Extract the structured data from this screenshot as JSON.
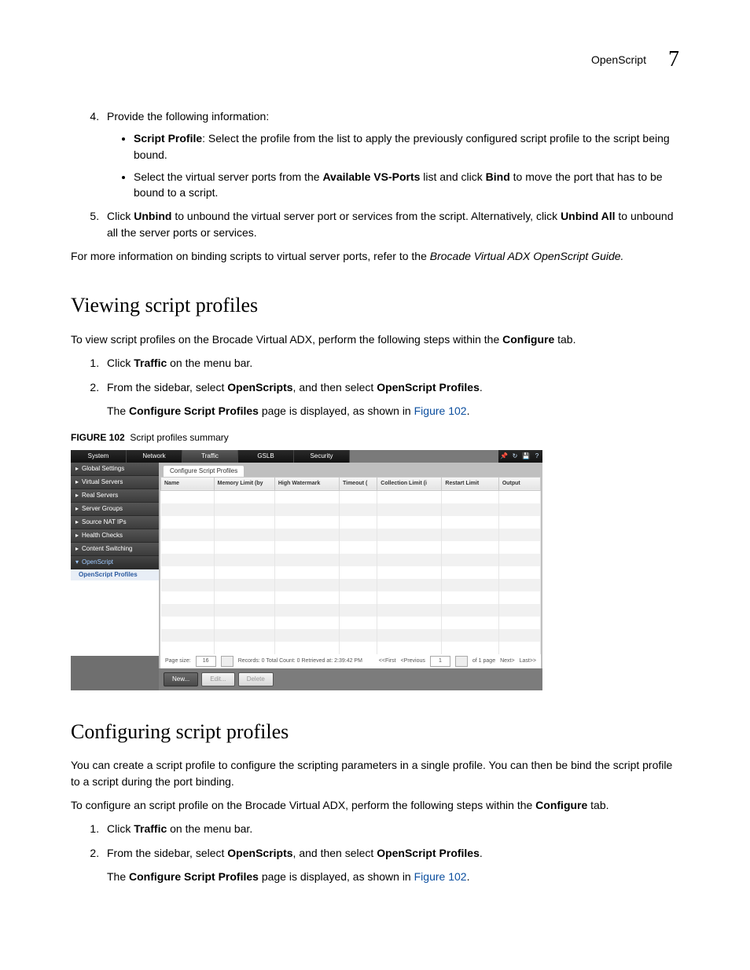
{
  "header": {
    "section": "OpenScript",
    "pagenum": "7"
  },
  "step4": {
    "num": "4.",
    "lead": "Provide the following information:",
    "b1_bold": "Script Profile",
    "b1_rest": ": Select the profile from the list to apply the previously configured script profile to the script being bound.",
    "b2_a": "Select the virtual server ports from the ",
    "b2_bold1": "Available VS-Ports",
    "b2_b": " list and click ",
    "b2_bold2": "Bind",
    "b2_c": " to move the port that has to be bound to a script."
  },
  "step5": {
    "num": "5.",
    "a": "Click ",
    "bold1": "Unbind",
    "b": " to unbound the virtual server port or services from the script. Alternatively, click ",
    "bold2": "Unbind All",
    "c": " to unbound all the server ports or services."
  },
  "para_ref": {
    "a": "For more information on binding scripts to virtual server ports, refer to the ",
    "i": "Brocade Virtual ADX OpenScript Guide."
  },
  "h_view": "Viewing script profiles",
  "view_intro_a": "To view script profiles on the Brocade Virtual ADX, perform the following steps within the ",
  "view_intro_bold": "Configure",
  "view_intro_b": " tab.",
  "vs1": {
    "a": "Click ",
    "bold": "Traffic",
    "b": " on the menu bar."
  },
  "vs2": {
    "a": "From the sidebar, select ",
    "b1": "OpenScripts",
    "b": ", and then select ",
    "b2": "OpenScript Profiles",
    "c": ".",
    "p_a": "The ",
    "p_bold": "Configure Script Profiles",
    "p_b": " page is displayed, as shown in ",
    "p_link": "Figure 102",
    "p_c": "."
  },
  "figcap_bold": "FIGURE 102",
  "figcap_rest": "Script profiles summary",
  "fig": {
    "tabs": [
      "System",
      "Network",
      "Traffic",
      "GSLB",
      "Security"
    ],
    "selected_tab_index": 2,
    "sidebar": [
      "Global Settings",
      "Virtual Servers",
      "Real Servers",
      "Server Groups",
      "Source NAT IPs",
      "Health Checks",
      "Content Switching",
      "OpenScript"
    ],
    "sidebar_sub": "OpenScript Profiles",
    "main_tab": "Configure Script Profiles",
    "cols": [
      "Name",
      "Memory Limit (by",
      "High Watermark",
      "Timeout (",
      "Collection Limit (i",
      "Restart Limit",
      "Output"
    ],
    "pager": {
      "pslabel": "Page size:",
      "ps": "16",
      "status": "Records: 0  Total Count: 0  Retrieved at: 2:39:42 PM",
      "first": "<<First",
      "prev": "<Previous",
      "cur": "1",
      "of": "of 1 page",
      "next": "Next>",
      "last": "Last>>"
    },
    "btns": [
      "New...",
      "Edit...",
      "Delete"
    ]
  },
  "h_cfg": "Configuring script profiles",
  "cfg_p1": "You can create a script profile to configure the scripting parameters in a single profile. You can then be bind the script profile to a script during the port binding.",
  "cfg_p2_a": "To configure an script profile on the Brocade Virtual ADX, perform the following steps within the ",
  "cfg_p2_bold": "Configure",
  "cfg_p2_b": " tab.",
  "cs1": {
    "a": "Click ",
    "bold": "Traffic",
    "b": " on the menu bar."
  },
  "cs2": {
    "a": "From the sidebar, select ",
    "b1": "OpenScripts",
    "b": ", and then select ",
    "b2": "OpenScript Profiles",
    "c": ".",
    "p_a": "The ",
    "p_bold": "Configure Script Profiles",
    "p_b": " page is displayed, as shown in ",
    "p_link": "Figure 102",
    "p_c": "."
  }
}
